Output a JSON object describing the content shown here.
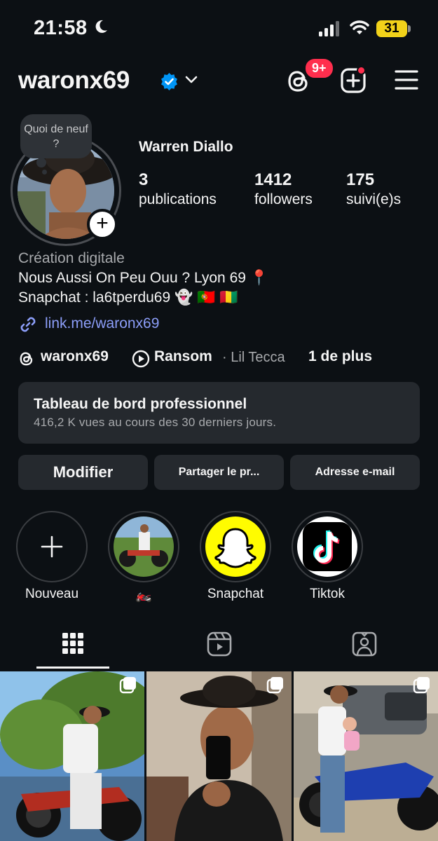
{
  "status_bar": {
    "time": "21:58",
    "battery": "31"
  },
  "header": {
    "username": "waronx69",
    "threads_badge": "9+"
  },
  "profile": {
    "note": "Quoi de neuf ?",
    "full_name": "Warren Diallo",
    "stats": [
      {
        "value": "3",
        "label": "publications"
      },
      {
        "value": "1412",
        "label": "followers"
      },
      {
        "value": "175",
        "label": "suivi(e)s"
      }
    ],
    "category": "Création digitale",
    "bio_line1": "Nous Aussi On Peu Ouu ? Lyon 69 📍",
    "bio_line2": "Snapchat : la6tperdu69 👻 🇵🇹 🇬🇳",
    "link": "link.me/waronx69",
    "threads_handle": "waronx69",
    "music_title": "Ransom",
    "music_artist": "· Lil Tecca",
    "more": "1 de plus"
  },
  "dashboard": {
    "title": "Tableau de bord professionnel",
    "subtitle": "416,2 K vues au cours des 30 derniers jours."
  },
  "buttons": {
    "edit": "Modifier",
    "share": "Partager le pr...",
    "email": "Adresse e-mail"
  },
  "highlights": [
    {
      "label": "Nouveau"
    },
    {
      "label": "🏍️"
    },
    {
      "label": "Snapchat"
    },
    {
      "label": "Tiktok"
    }
  ],
  "colors": {
    "background": "#0c1014",
    "card": "#25292e",
    "link": "#8c9ef9",
    "badge": "#ff2e4d",
    "verified": "#0095f6"
  }
}
